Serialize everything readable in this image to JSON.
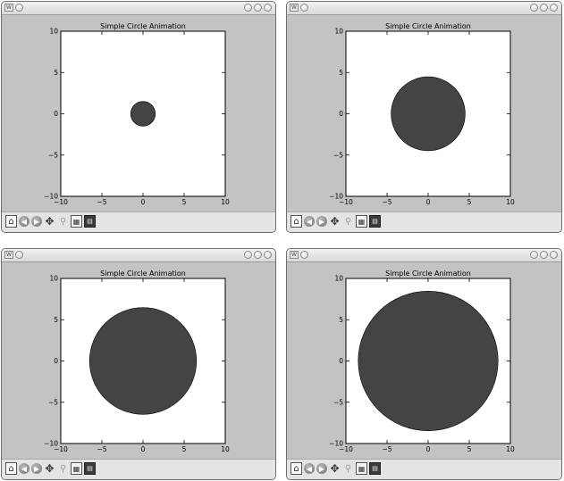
{
  "windows": [
    {
      "id": "win-1",
      "chart_title": "Simple Circle Animation",
      "chart_data": {
        "type": "scatter",
        "title": "Simple Circle Animation",
        "xlim": [
          -10,
          10
        ],
        "ylim": [
          -10,
          10
        ],
        "xticks": [
          "−10",
          "−5",
          "0",
          "5",
          "10"
        ],
        "yticks": [
          "10",
          "5",
          "0",
          "−5",
          "−10"
        ],
        "circle": {
          "cx": 0,
          "cy": 0,
          "r": 1.5,
          "color": "#444444"
        }
      }
    },
    {
      "id": "win-2",
      "chart_title": "Simple Circle Animation",
      "chart_data": {
        "type": "scatter",
        "title": "Simple Circle Animation",
        "xlim": [
          -10,
          10
        ],
        "ylim": [
          -10,
          10
        ],
        "xticks": [
          "−10",
          "−5",
          "0",
          "5",
          "10"
        ],
        "yticks": [
          "10",
          "5",
          "0",
          "−5",
          "−10"
        ],
        "circle": {
          "cx": 0,
          "cy": 0,
          "r": 4.5,
          "color": "#444444"
        }
      }
    },
    {
      "id": "win-3",
      "chart_title": "Simple Circle Animation",
      "chart_data": {
        "type": "scatter",
        "title": "Simple Circle Animation",
        "xlim": [
          -10,
          10
        ],
        "ylim": [
          -10,
          10
        ],
        "xticks": [
          "−10",
          "−5",
          "0",
          "5",
          "10"
        ],
        "yticks": [
          "10",
          "5",
          "0",
          "−5",
          "−10"
        ],
        "circle": {
          "cx": 0,
          "cy": 0,
          "r": 6.5,
          "color": "#444444"
        }
      }
    },
    {
      "id": "win-4",
      "chart_title": "Simple Circle Animation",
      "chart_data": {
        "type": "scatter",
        "title": "Simple Circle Animation",
        "xlim": [
          -10,
          10
        ],
        "ylim": [
          -10,
          10
        ],
        "xticks": [
          "−10",
          "−5",
          "0",
          "5",
          "10"
        ],
        "yticks": [
          "10",
          "5",
          "0",
          "−5",
          "−10"
        ],
        "circle": {
          "cx": 0,
          "cy": 0,
          "r": 8.5,
          "color": "#444444"
        }
      }
    }
  ],
  "toolbar_icons": [
    "home-icon",
    "back-icon",
    "forward-icon",
    "pan-icon",
    "zoom-icon",
    "subplots-icon",
    "save-icon"
  ],
  "colors": {
    "window_bg": "#c3c3c3",
    "plot_bg": "#ffffff",
    "circle_fill": "#444444"
  }
}
